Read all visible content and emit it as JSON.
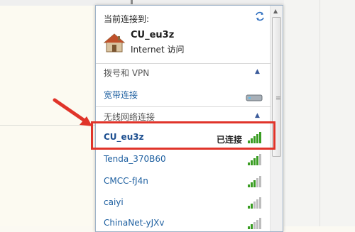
{
  "popup": {
    "header_label": "当前连接到:",
    "current_network": {
      "name": "CU_eu3z",
      "status": "Internet 访问"
    },
    "dialup_section": {
      "title": "拨号和 VPN",
      "item": "宽带连接"
    },
    "wireless_section": {
      "title": "无线网络连接"
    },
    "networks": [
      {
        "name": "CU_eu3z",
        "connected_label": "已连接"
      },
      {
        "name": "Tenda_370B60"
      },
      {
        "name": "CMCC-fJ4n"
      },
      {
        "name": "caiyi"
      },
      {
        "name": "ChinaNet-yJXv"
      }
    ]
  },
  "colors": {
    "link_blue": "#1d5fa0",
    "highlight_red": "#e0342a",
    "signal_green": "#3a9d23"
  },
  "icons": [
    "refresh-icon",
    "house-icon",
    "modem-icon",
    "wifi-signal-icon",
    "chevron-up-icon",
    "arrow-pointer"
  ]
}
